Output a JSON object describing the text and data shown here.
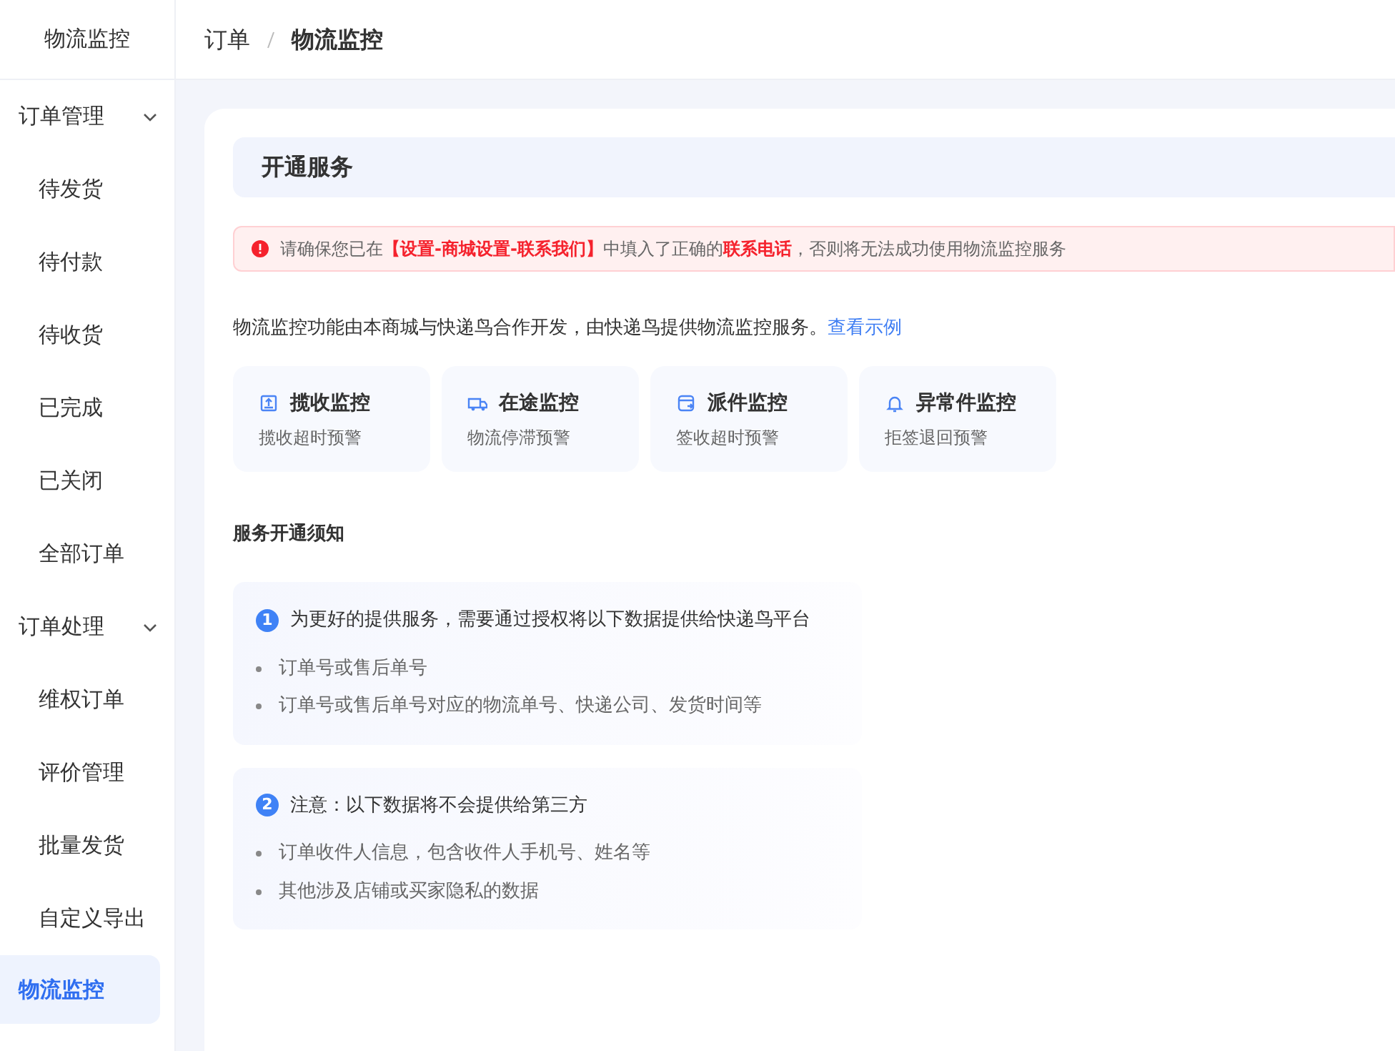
{
  "sidebar": {
    "title": "物流监控",
    "groups": [
      {
        "label": "订单管理",
        "expanded": true,
        "items": [
          {
            "label": "待发货",
            "selected": false
          },
          {
            "label": "待付款",
            "selected": false
          },
          {
            "label": "待收货",
            "selected": false
          },
          {
            "label": "已完成",
            "selected": false
          },
          {
            "label": "已关闭",
            "selected": false
          },
          {
            "label": "全部订单",
            "selected": false
          }
        ]
      },
      {
        "label": "订单处理",
        "expanded": true,
        "items": [
          {
            "label": "维权订单",
            "selected": false
          },
          {
            "label": "评价管理",
            "selected": false
          },
          {
            "label": "批量发货",
            "selected": false
          },
          {
            "label": "自定义导出",
            "selected": false
          },
          {
            "label": "物流监控",
            "selected": true
          }
        ]
      }
    ]
  },
  "breadcrumb": [
    "订单",
    "物流监控"
  ],
  "section_title": "开通服务",
  "alert": "请确保您已在**【设置-商城设置-联系我们】**中填入了正确的**联系电话**，否则将无法成功使用物流监控服务",
  "intro": {
    "text": "物流监控功能由本商城与快递鸟合作开发，由快递鸟提供物流监控服务。",
    "link": "查看示例"
  },
  "features": [
    {
      "kind": "pickup",
      "title": "揽收监控",
      "subtitle": "揽收超时预警"
    },
    {
      "kind": "transit",
      "title": "在途监控",
      "subtitle": "物流停滞预警"
    },
    {
      "kind": "delivery",
      "title": "派件监控",
      "subtitle": "签收超时预警"
    },
    {
      "kind": "exception",
      "title": "异常件监控",
      "subtitle": "拒签退回预警"
    }
  ],
  "notice_title": "服务开通须知",
  "notices": [
    {
      "number": "1",
      "title": "为更好的提供服务，需要通过授权将以下数据提供给快递鸟平台",
      "items": [
        "订单号或售后单号",
        "订单号或售后单号对应的物流单号、快递公司、发货时间等"
      ]
    },
    {
      "number": "2",
      "title": "注意：以下数据将不会提供给第三方",
      "items": [
        "订单收件人信息，包含收件人手机号、姓名等",
        "其他涉及店铺或买家隐私的数据"
      ]
    }
  ]
}
